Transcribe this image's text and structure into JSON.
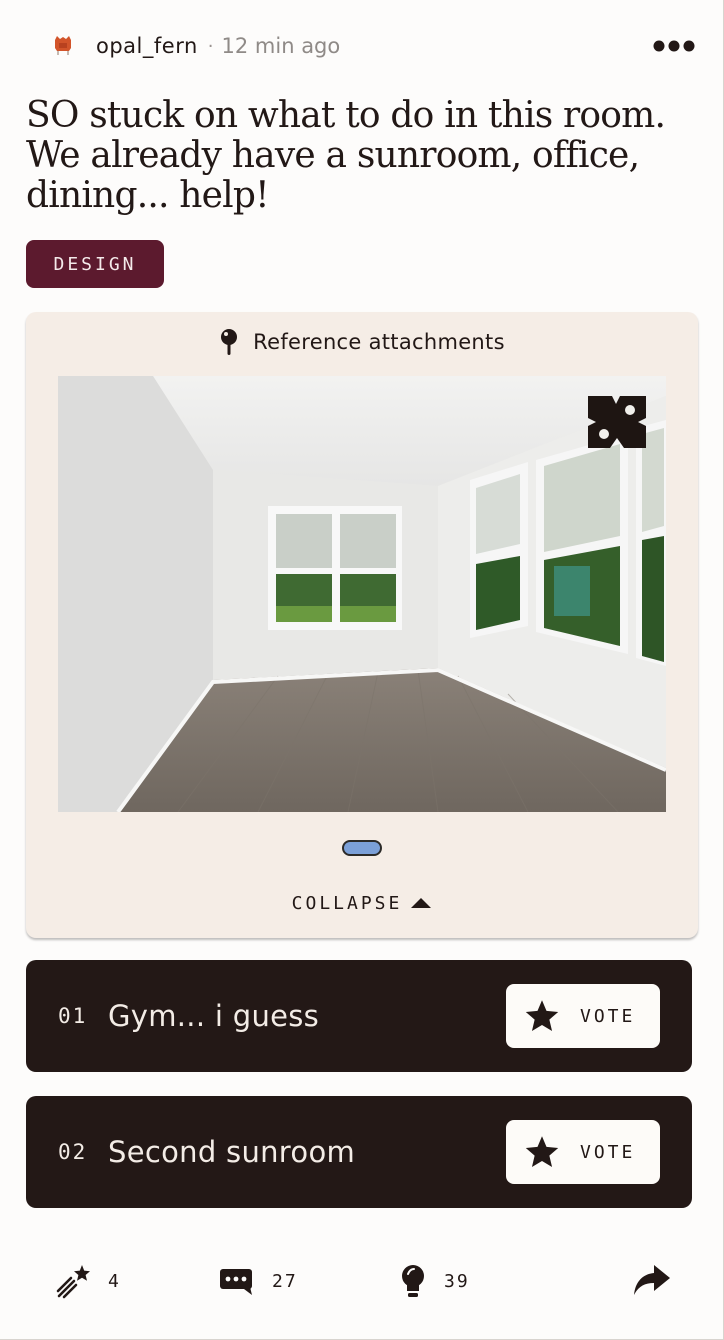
{
  "post": {
    "author": "opal_fern",
    "separator": "·",
    "time_ago": "12 min ago",
    "title": "SO stuck on what to do in this room. We already have a sunroom, office, dining... help!",
    "tag": "DESIGN"
  },
  "attachments": {
    "label": "Reference attachments",
    "image_alt": "Empty room with white walls, wood floor and windows",
    "collapse_label": "COLLAPSE"
  },
  "options": [
    {
      "number": "01",
      "label": "Gym... i guess",
      "vote_label": "VOTE"
    },
    {
      "number": "02",
      "label": "Second sunroom",
      "vote_label": "VOTE"
    }
  ],
  "footer": {
    "boosts": "4",
    "comments": "27",
    "ideas": "39"
  },
  "colors": {
    "tag_bg": "#5c1a2e",
    "option_bg": "#231816",
    "panel_bg": "#f5ede6",
    "pager_dot": "#7ba0d8",
    "avatar_accent": "#d2542a"
  }
}
